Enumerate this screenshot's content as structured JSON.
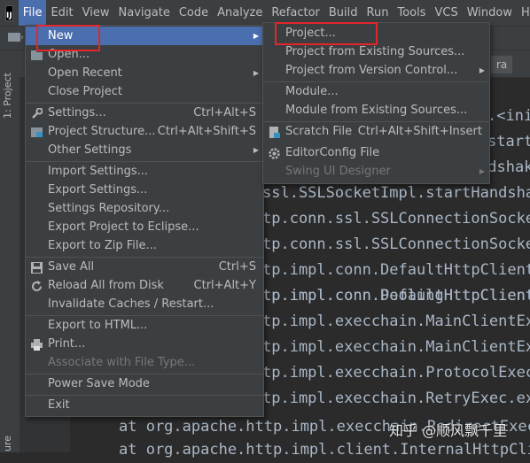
{
  "menubar": {
    "app_icon_text": "IJ",
    "items": [
      {
        "label": "File",
        "active": true
      },
      {
        "label": "Edit"
      },
      {
        "label": "View"
      },
      {
        "label": "Navigate"
      },
      {
        "label": "Code"
      },
      {
        "label": "Analyze"
      },
      {
        "label": "Refactor"
      },
      {
        "label": "Build"
      },
      {
        "label": "Run"
      },
      {
        "label": "Tools"
      },
      {
        "label": "VCS"
      },
      {
        "label": "Window"
      },
      {
        "label": "He"
      }
    ]
  },
  "side_strip": {
    "project_label": "1: Project",
    "bottom_label": "ure"
  },
  "editor_tab": {
    "label": "ra"
  },
  "code_lines": [
    ".<ini",
    "start(",
    "ndshak",
    "ssl.SSLSocketImpl.startHandshak",
    "tp.conn.ssl.SSLConnectionSocket",
    "tp.conn.ssl.SSLConnectionSocket",
    "tp.impl.conn.DefaultHttpClientC",
    "tp.impl.conn.PoolingHttpClientC",
    "tp.impl.execchain.MainClientExe",
    "tp.impl.execchain.MainClientExe",
    "tp.impl.execchain.ProtocolExec",
    "tp.impl.execchain.RetryExec.exe",
    "at org.apache.http.impl.execchain.RedirectExec",
    "at org.apache.http.impl.client.InternalHttpCli"
  ],
  "file_menu": {
    "items": [
      {
        "label": "New",
        "shortcut": "",
        "submenu": true,
        "selected": true
      },
      {
        "label": "Open...",
        "shortcut": ""
      },
      {
        "label": "Open Recent",
        "shortcut": "",
        "submenu": true
      },
      {
        "label": "Close Project",
        "shortcut": ""
      },
      {
        "label": "Settings...",
        "shortcut": "Ctrl+Alt+S"
      },
      {
        "label": "Project Structure...",
        "shortcut": "Ctrl+Alt+Shift+S"
      },
      {
        "label": "Other Settings",
        "shortcut": "",
        "submenu": true
      },
      {
        "label": "Import Settings...",
        "shortcut": ""
      },
      {
        "label": "Export Settings...",
        "shortcut": ""
      },
      {
        "label": "Settings Repository...",
        "shortcut": ""
      },
      {
        "label": "Export Project to Eclipse...",
        "shortcut": ""
      },
      {
        "label": "Export to Zip File...",
        "shortcut": ""
      },
      {
        "label": "Save All",
        "shortcut": "Ctrl+S"
      },
      {
        "label": "Reload All from Disk",
        "shortcut": "Ctrl+Alt+Y"
      },
      {
        "label": "Invalidate Caches / Restart...",
        "shortcut": ""
      },
      {
        "label": "Export to HTML...",
        "shortcut": ""
      },
      {
        "label": "Print...",
        "shortcut": ""
      },
      {
        "label": "Associate with File Type...",
        "shortcut": "",
        "disabled": true
      },
      {
        "label": "Power Save Mode",
        "shortcut": ""
      },
      {
        "label": "Exit",
        "shortcut": ""
      }
    ]
  },
  "new_menu": {
    "items": [
      {
        "label": "Project...",
        "shortcut": ""
      },
      {
        "label": "Project from Existing Sources...",
        "shortcut": ""
      },
      {
        "label": "Project from Version Control...",
        "shortcut": "",
        "submenu": true
      },
      {
        "label": "Module...",
        "shortcut": ""
      },
      {
        "label": "Module from Existing Sources...",
        "shortcut": ""
      },
      {
        "label": "Scratch File",
        "shortcut": "Ctrl+Alt+Shift+Insert"
      },
      {
        "label": "EditorConfig File",
        "shortcut": ""
      },
      {
        "label": "Swing UI Designer",
        "shortcut": "",
        "submenu": true,
        "disabled": true
      }
    ]
  },
  "watermark": {
    "text": "知乎 @顺风飘千里"
  },
  "colors": {
    "highlight": "#4b6eaf",
    "annotation_box": "#e3262b",
    "menu_bg": "#3c3f41"
  }
}
